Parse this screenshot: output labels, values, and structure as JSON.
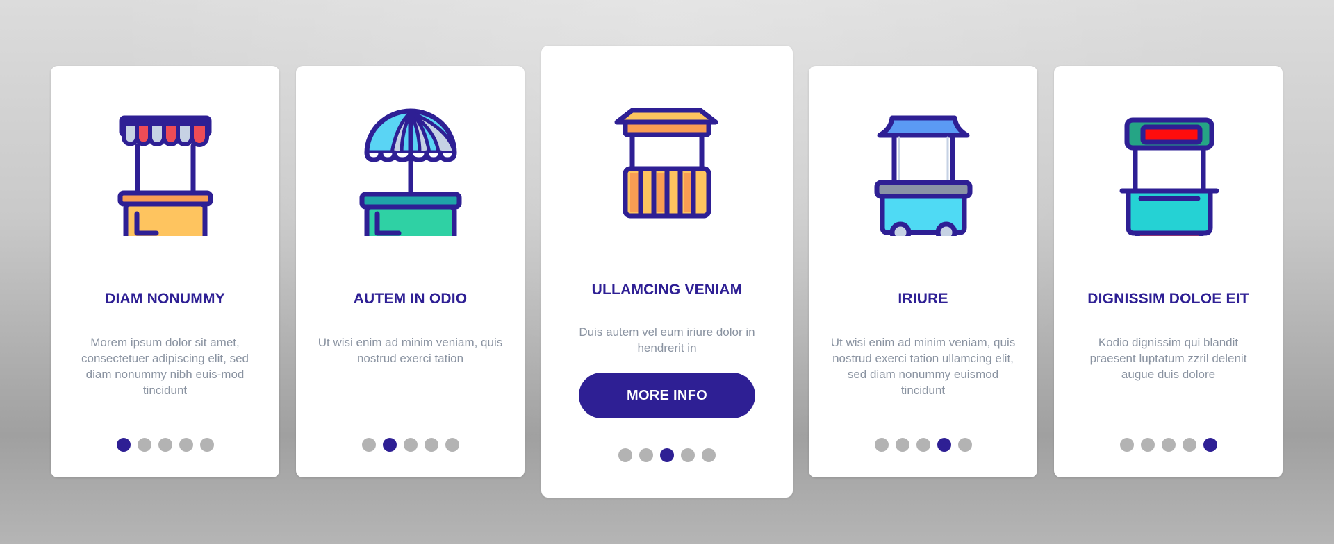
{
  "colors": {
    "accent": "#2e1f94",
    "dot_inactive": "#b3b3b3",
    "text_muted": "#8a93a1",
    "card_bg": "#ffffff"
  },
  "cards": [
    {
      "icon": "market-stall-striped-awning-icon",
      "title": "DIAM NONUMMY",
      "description": "Morem ipsum dolor sit amet, consectetuer adipiscing elit, sed diam nonummy nibh euis-mod tincidunt",
      "active_page": 1
    },
    {
      "icon": "umbrella-stall-icon",
      "title": "AUTEM IN ODIO",
      "description": "Ut wisi enim ad minim veniam, quis nostrud exerci tation",
      "active_page": 2
    },
    {
      "icon": "kiosk-booth-icon",
      "title": "ULLAMCING VENIAM",
      "description": "Duis autem vel eum iriure dolor in hendrerit in",
      "button_label": "MORE INFO",
      "active_page": 3
    },
    {
      "icon": "food-cart-icon",
      "title": "IRIURE",
      "description": "Ut wisi enim ad minim veniam, quis nostrud exerci tation ullamcing elit, sed diam nonummy euismod tincidunt",
      "active_page": 4
    },
    {
      "icon": "signboard-stand-icon",
      "title": "DIGNISSIM DOLOE EIT",
      "description": "Kodio dignissim qui blandit praesent luptatum zzril delenit augue duis dolore",
      "active_page": 5
    }
  ],
  "pagination": {
    "total_pages": 5
  }
}
